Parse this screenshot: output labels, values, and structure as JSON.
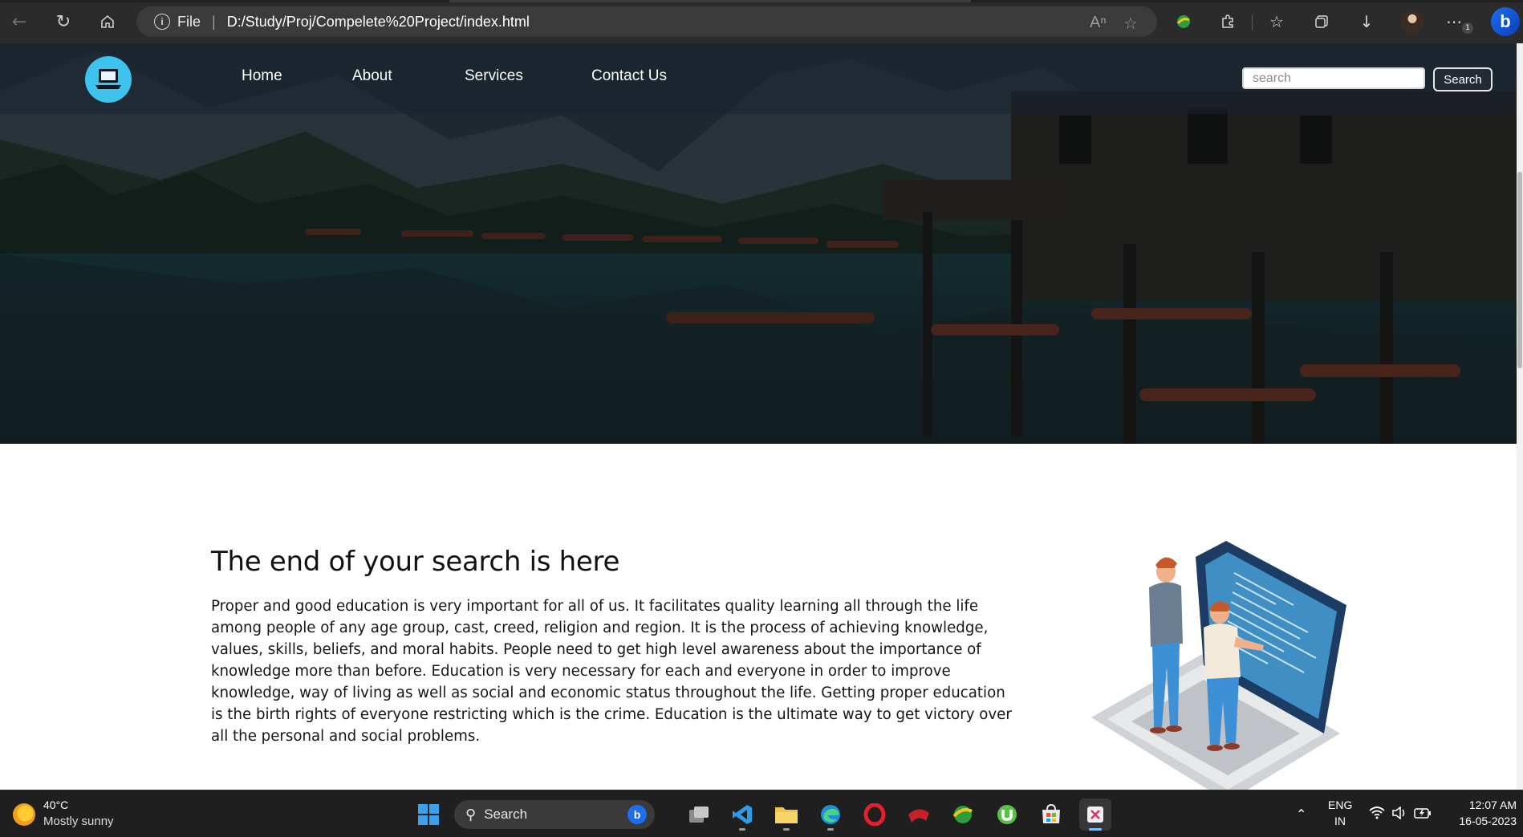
{
  "browser": {
    "address_protocol": "File",
    "address_separator": "|",
    "url": "D:/Study/Proj/Compelete%20Project/index.html",
    "notification_count": "1",
    "bing_label": "b"
  },
  "site": {
    "nav": {
      "home": "Home",
      "about": "About",
      "services": "Services",
      "contact": "Contact Us"
    },
    "search": {
      "placeholder": "search",
      "button_label": "Search"
    },
    "headline": "The end of your search is here",
    "body": "Proper and good education is very important for all of us. It facilitates quality learning all through the life among people of any age group, cast, creed, religion and region. It is the process of achieving knowledge, values, skills, beliefs, and moral habits. People need to get high level awareness about the importance of knowledge more than before. Education is very necessary for each and everyone in order to improve knowledge, way of living as well as social and economic status throughout the life. Getting proper education is the birth rights of everyone restricting which is the crime. Education is the ultimate way to get victory over all the personal and social problems."
  },
  "taskbar": {
    "weather_temp": "40°C",
    "weather_desc": "Mostly sunny",
    "search_label": "Search",
    "lang_line1": "ENG",
    "lang_line2": "IN",
    "time": "12:07 AM",
    "date": "16-05-2023"
  },
  "colors": {
    "logo_bg": "#3ec4ec",
    "taskbar_bg": "#1f1f1f",
    "browser_bg": "#2b2b2b"
  }
}
